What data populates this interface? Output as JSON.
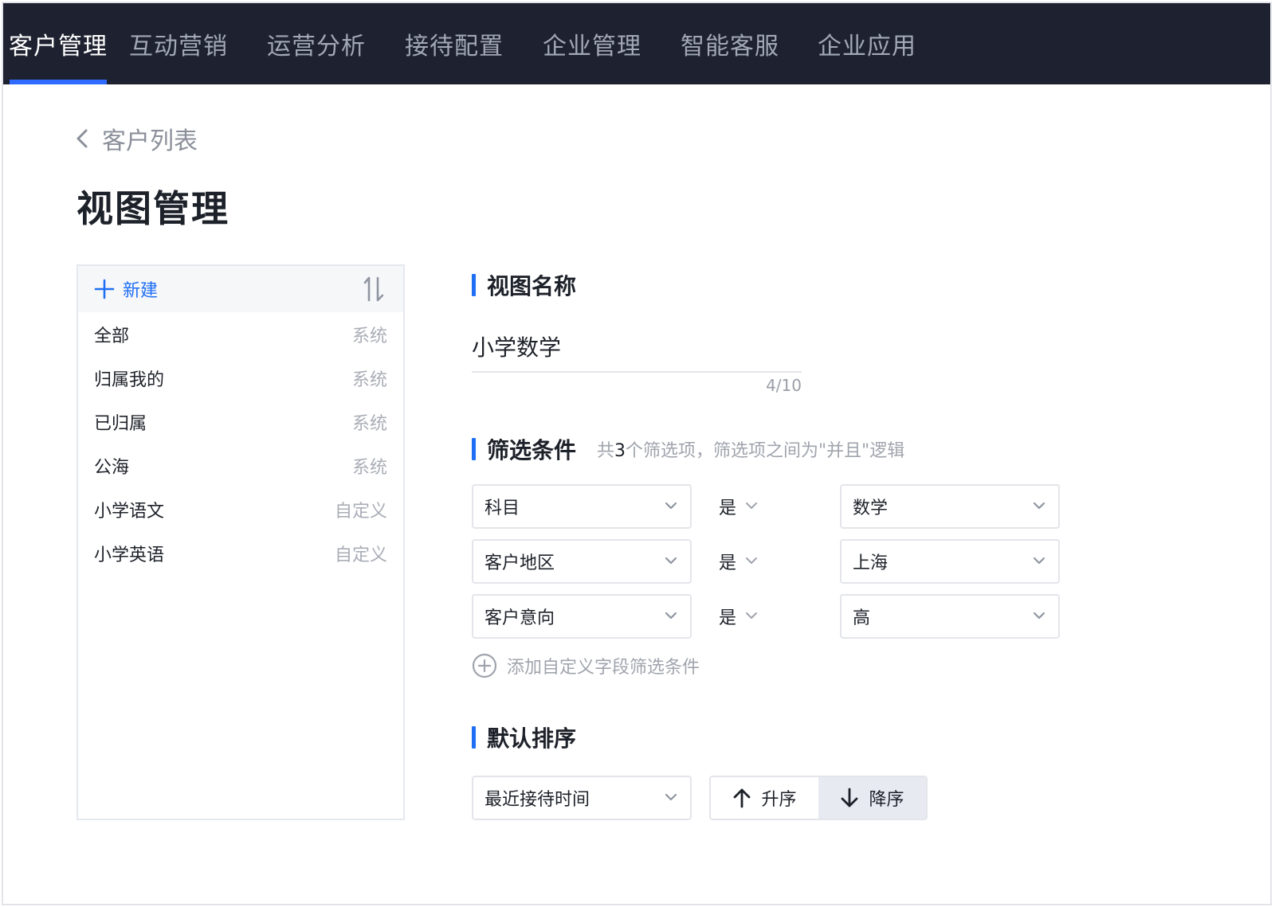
{
  "nav": {
    "items": [
      {
        "label": "客户管理",
        "active": true
      },
      {
        "label": "互动营销",
        "active": false
      },
      {
        "label": "运营分析",
        "active": false
      },
      {
        "label": "接待配置",
        "active": false
      },
      {
        "label": "企业管理",
        "active": false
      },
      {
        "label": "智能客服",
        "active": false
      },
      {
        "label": "企业应用",
        "active": false
      }
    ]
  },
  "breadcrumb": {
    "back_label": "客户列表"
  },
  "page": {
    "title": "视图管理"
  },
  "sidebar": {
    "new_label": "新建",
    "items": [
      {
        "name": "全部",
        "tag": "系统"
      },
      {
        "name": "归属我的",
        "tag": "系统"
      },
      {
        "name": "已归属",
        "tag": "系统"
      },
      {
        "name": "公海",
        "tag": "系统"
      },
      {
        "name": "小学语文",
        "tag": "自定义"
      },
      {
        "name": "小学英语",
        "tag": "自定义"
      }
    ]
  },
  "view_name": {
    "section_title": "视图名称",
    "value": "小学数学",
    "counter": "4/10"
  },
  "filters": {
    "section_title": "筛选条件",
    "hint_prefix": "共",
    "hint_count": "3",
    "hint_suffix": "个筛选项，筛选项之间为\"并且\"逻辑",
    "conditions": [
      {
        "field": "科目",
        "operator": "是",
        "value": "数学"
      },
      {
        "field": "客户地区",
        "operator": "是",
        "value": "上海"
      },
      {
        "field": "客户意向",
        "operator": "是",
        "value": "高"
      }
    ],
    "add_label": "添加自定义字段筛选条件"
  },
  "sort": {
    "section_title": "默认排序",
    "field": "最近接待时间",
    "asc_label": "升序",
    "desc_label": "降序",
    "selected": "desc"
  },
  "colors": {
    "nav_bg": "#1e2230",
    "accent": "#1f6ff5",
    "nav_active_underline": "#2f6bff"
  }
}
